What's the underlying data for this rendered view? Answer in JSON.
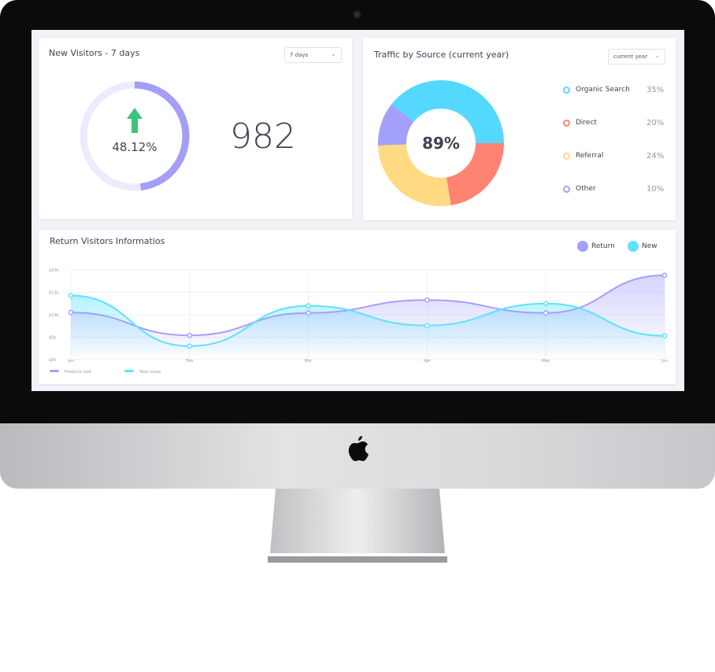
{
  "visitors": {
    "title": "New Visitors - 7 days",
    "select": "7 days",
    "percent": "48.12%",
    "progress": 48.12,
    "count": "982",
    "colors": {
      "ring": "#a39ef7",
      "track": "#ecebfc",
      "arrow": "#3cc47c"
    }
  },
  "traffic": {
    "title": "Traffic by Source (current year)",
    "select": "current year",
    "center": "89%",
    "sources": [
      {
        "label": "Organic Search",
        "pct": "35%",
        "value": 35,
        "color": "#55d8fe"
      },
      {
        "label": "Direct",
        "pct": "20%",
        "value": 20,
        "color": "#ff8373"
      },
      {
        "label": "Referral",
        "pct": "24%",
        "value": 24,
        "color": "#ffda83"
      },
      {
        "label": "Other",
        "pct": "10%",
        "value": 10,
        "color": "#a3a0fb"
      }
    ]
  },
  "chart_data": {
    "type": "area",
    "title": "Return Visitors Informatios",
    "legend_top": [
      {
        "label": "Return",
        "color": "#a3a0fb"
      },
      {
        "label": "New",
        "color": "#5ee2ff"
      }
    ],
    "legend_bottom": [
      {
        "label": "Products sold",
        "color": "#a3a0fb"
      },
      {
        "label": "Total views",
        "color": "#5ee2ff"
      }
    ],
    "categories": [
      "Jan",
      "Feb",
      "Mar",
      "Apr",
      "May",
      "Jun"
    ],
    "yticks": [
      "$20k",
      "$15k",
      "$10k",
      "$5k",
      "$0k"
    ],
    "ylim": [
      0,
      20000
    ],
    "series": [
      {
        "name": "Products sold",
        "color": "#a3a0fb",
        "values": [
          10500,
          5400,
          10400,
          13300,
          10400,
          18800
        ]
      },
      {
        "name": "Total views",
        "color": "#5ee2ff",
        "values": [
          14300,
          3000,
          12000,
          7600,
          12500,
          5300
        ]
      }
    ]
  }
}
